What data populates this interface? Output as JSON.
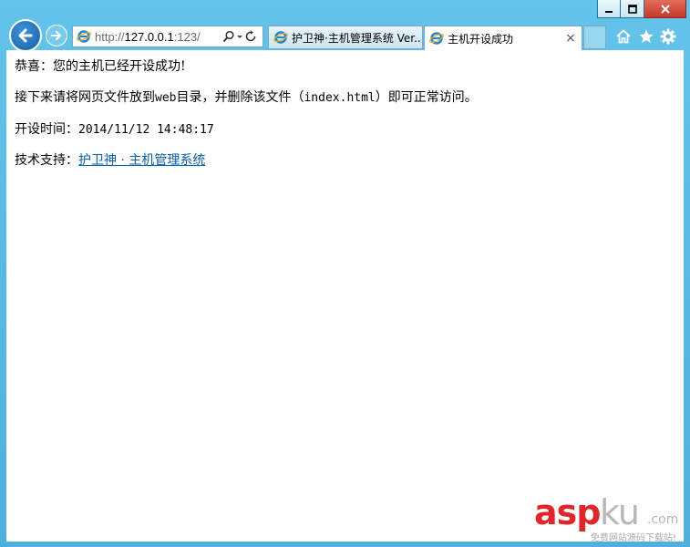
{
  "window": {
    "minimize_icon": "minimize-icon",
    "maximize_icon": "maximize-icon",
    "close_icon": "close-icon"
  },
  "toolbar": {
    "back_icon": "back-arrow-icon",
    "forward_icon": "forward-arrow-icon",
    "address": {
      "prefix": "http://",
      "host": "127.0.0.1",
      "suffix": ":123/"
    },
    "tools": [
      "search-icon",
      "dropdown-icon",
      "refresh-icon"
    ],
    "right_icons": [
      "home-icon",
      "favorites-star-icon",
      "settings-gear-icon"
    ]
  },
  "tabs": [
    {
      "label": "护卫神·主机管理系统 Ver...",
      "active": false
    },
    {
      "label": "主机开设成功",
      "active": true,
      "close": "×"
    }
  ],
  "content": {
    "line1": "恭喜：您的主机已经开设成功!",
    "line2_pre": "接下来请将网页文件放到",
    "line2_web": "web",
    "line2_mid": "目录，并删除该文件（",
    "line2_file": "index.html",
    "line2_post": "）即可正常访问。",
    "time_label": "开设时间：",
    "time_value": "2014/11/12 14:48:17",
    "support_label": "技术支持：",
    "support_link": "护卫神 · 主机管理系统"
  },
  "watermark": {
    "asp": "asp",
    "ku": "ku",
    "com": ".com",
    "sub": "免费网站源码下载站!"
  }
}
